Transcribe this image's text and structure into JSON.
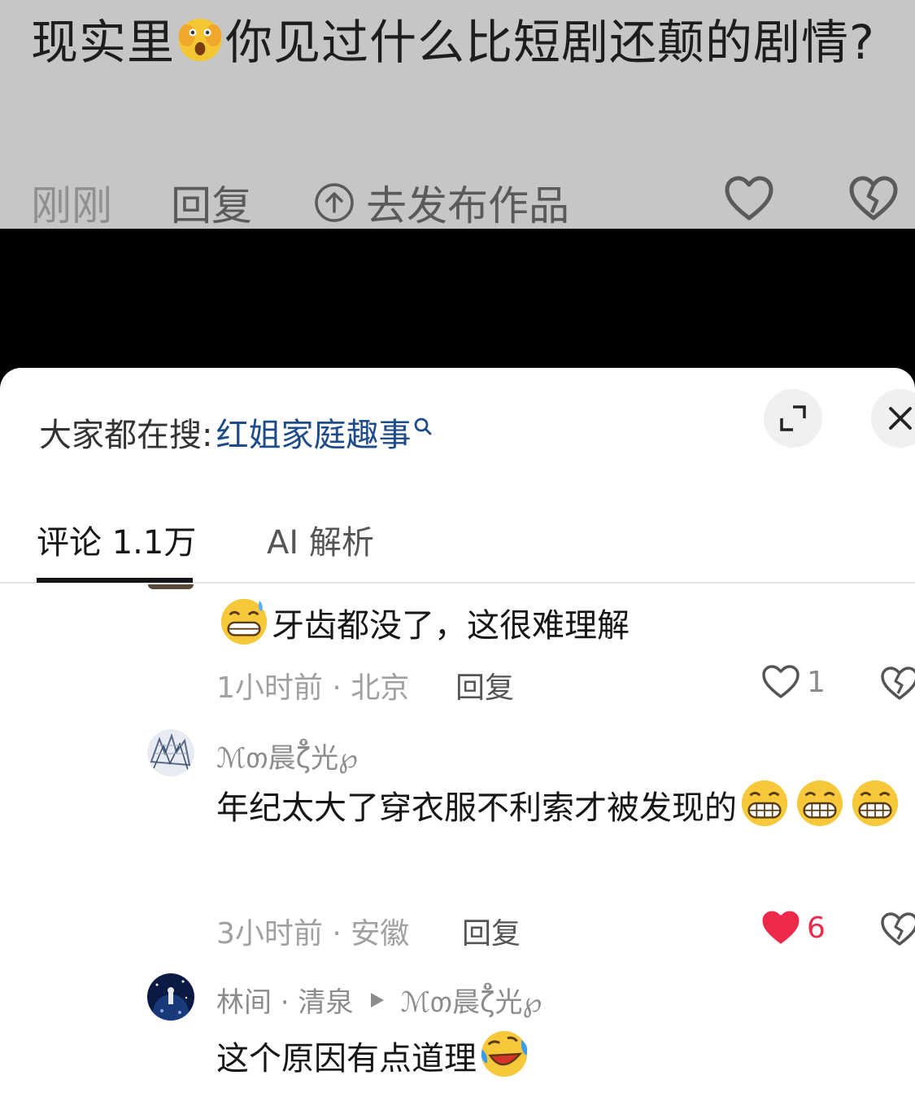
{
  "post": {
    "text_part1": "现实里",
    "emoji1": "face-with-hand-over-mouth-emoji",
    "text_part2": "你见过什么比短剧还颠的剧情?",
    "time": "刚刚",
    "reply": "回复",
    "publish": "去发布作品"
  },
  "sheet": {
    "search_prefix": "大家都在搜:",
    "search_term": "红姐家庭趣事",
    "tabs": [
      {
        "label": "评论 1.1万"
      },
      {
        "label": "AI 解析"
      }
    ]
  },
  "comments": [
    {
      "text": "牙齿都没了，这很难理解",
      "emoji": "grinning-sweat-emoji",
      "time": "1小时前 · 北京",
      "reply": "回复",
      "likes": "1",
      "liked": false
    },
    {
      "name": "ℳთ晨ζ̊̈光℘",
      "text": "年纪太大了穿衣服不利索才被发现的",
      "emoji": "grinning-face-emoji",
      "time": "3小时前 · 安徽",
      "reply": "回复",
      "likes": "6",
      "liked": true
    },
    {
      "name": "林间 · 清泉",
      "reply_to": "ℳთ晨ζ̊̈光℘",
      "text": "这个原因有点道理",
      "emoji": "laughing-crying-emoji"
    }
  ],
  "colors": {
    "accent_red": "#ee2a4a",
    "search_blue": "#1e4b8a"
  }
}
